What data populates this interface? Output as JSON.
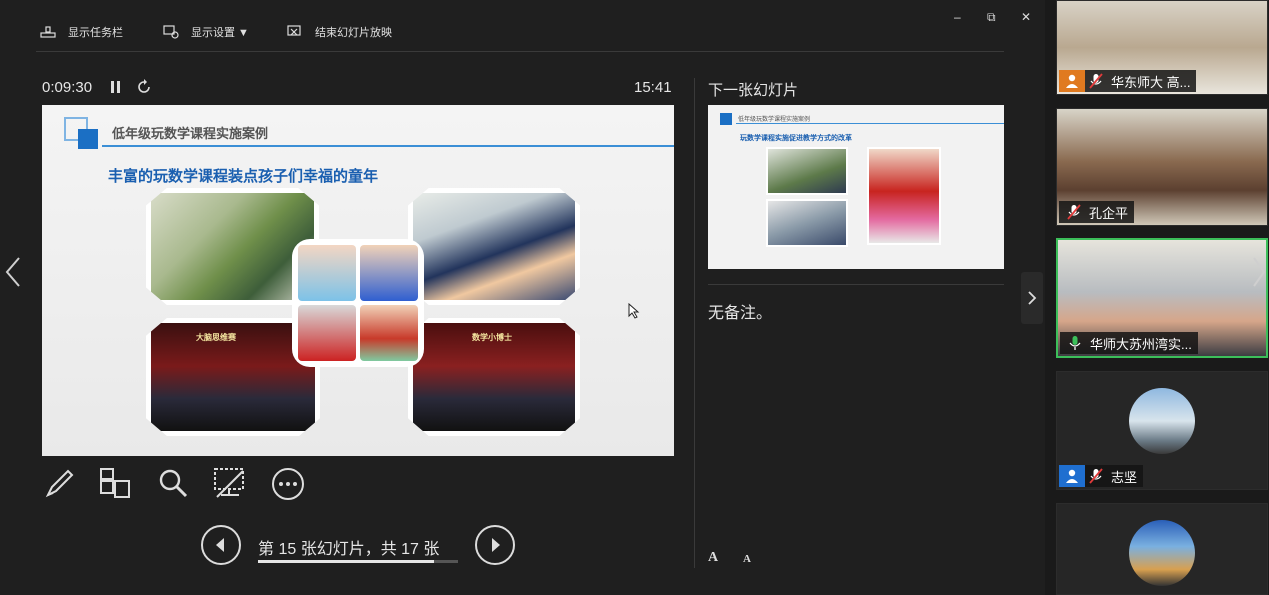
{
  "toolbar": {
    "taskbar_label": "显示任务栏",
    "display_label": "显示设置 ▼",
    "end_label": "结束幻灯片放映"
  },
  "window_controls": {
    "minimize": "–",
    "restore": "⧉",
    "close": "✕"
  },
  "timer": "0:09:30",
  "clock": "15:41",
  "current_slide": {
    "header": "低年级玩数学课程实施案例",
    "title": "丰富的玩数学课程装点孩子们幸福的童年",
    "stage_text_1": "大脑思维赛",
    "stage_text_2": "数学小博士"
  },
  "next_slide": {
    "label": "下一张幻灯片",
    "header": "低年级玩数学课程实施案例",
    "title": "玩数学课程实施促进教学方式的改革"
  },
  "notes": "无备注。",
  "navigation": {
    "counter": "第 15 张幻灯片，共 17 张",
    "current": 15,
    "total": 17
  },
  "font_controls": {
    "increase": "A",
    "decrease": "A"
  },
  "participants": [
    {
      "name": "华东师大 高...",
      "muted": true,
      "avatar_color": "#e07a20"
    },
    {
      "name": "孔企平",
      "muted": true
    },
    {
      "name": "华师大苏州湾实...",
      "muted": false,
      "active": true,
      "mic_color": "#3cbf5a"
    },
    {
      "name": "志坚",
      "muted": true,
      "avatar_color": "#1f6fd0"
    }
  ],
  "colors": {
    "accent": "#3b8fd6",
    "active_speaker": "#3cbf5a",
    "muted": "#e23b3b"
  }
}
